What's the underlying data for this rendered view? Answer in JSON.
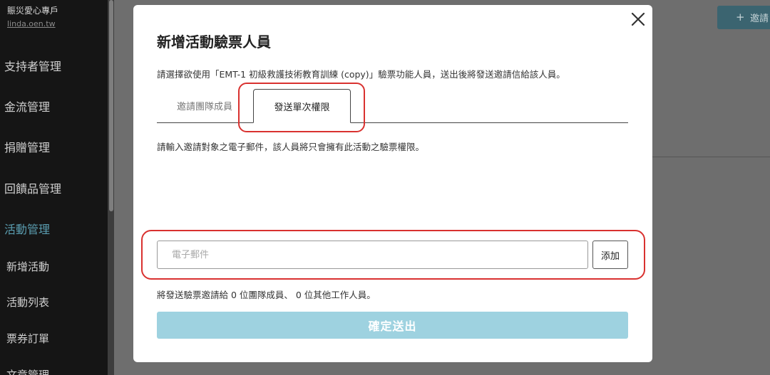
{
  "sidebar": {
    "brand_name": "賑災愛心專戶",
    "brand_url": "linda.oen.tw",
    "items": [
      {
        "label": "支持者管理",
        "active": false
      },
      {
        "label": "金流管理",
        "active": false
      },
      {
        "label": "捐贈管理",
        "active": false
      },
      {
        "label": "回饋品管理",
        "active": false
      },
      {
        "label": "活動管理",
        "active": true
      }
    ],
    "sub_items": [
      {
        "label": "新增活動"
      },
      {
        "label": "活動列表"
      },
      {
        "label": "票券訂單"
      },
      {
        "label": "文章管理"
      }
    ]
  },
  "main": {
    "invite_button_label": "邀請"
  },
  "modal": {
    "title": "新增活動驗票人員",
    "description": "請選擇欲使用「EMT-1 初級救護技術教育訓練 (copy)」驗票功能人員，送出後將發送邀請信給該人員。",
    "tabs": [
      {
        "label": "邀請團隊成員",
        "active": false
      },
      {
        "label": "發送單次權限",
        "active": true
      }
    ],
    "tab_description": "請輸入邀請對象之電子郵件，該人員將只會擁有此活動之驗票權限。",
    "email_placeholder": "電子郵件",
    "email_value": "",
    "add_button_label": "添加",
    "summary": "將發送驗票邀請給 0 位團隊成員、 0 位其他工作人員。",
    "submit_label": "確定送出"
  },
  "colors": {
    "sidebar_bg": "#151515",
    "active_nav": "#5a9db0",
    "submit_disabled": "#9ed2e0",
    "annotation": "#d9312f"
  }
}
